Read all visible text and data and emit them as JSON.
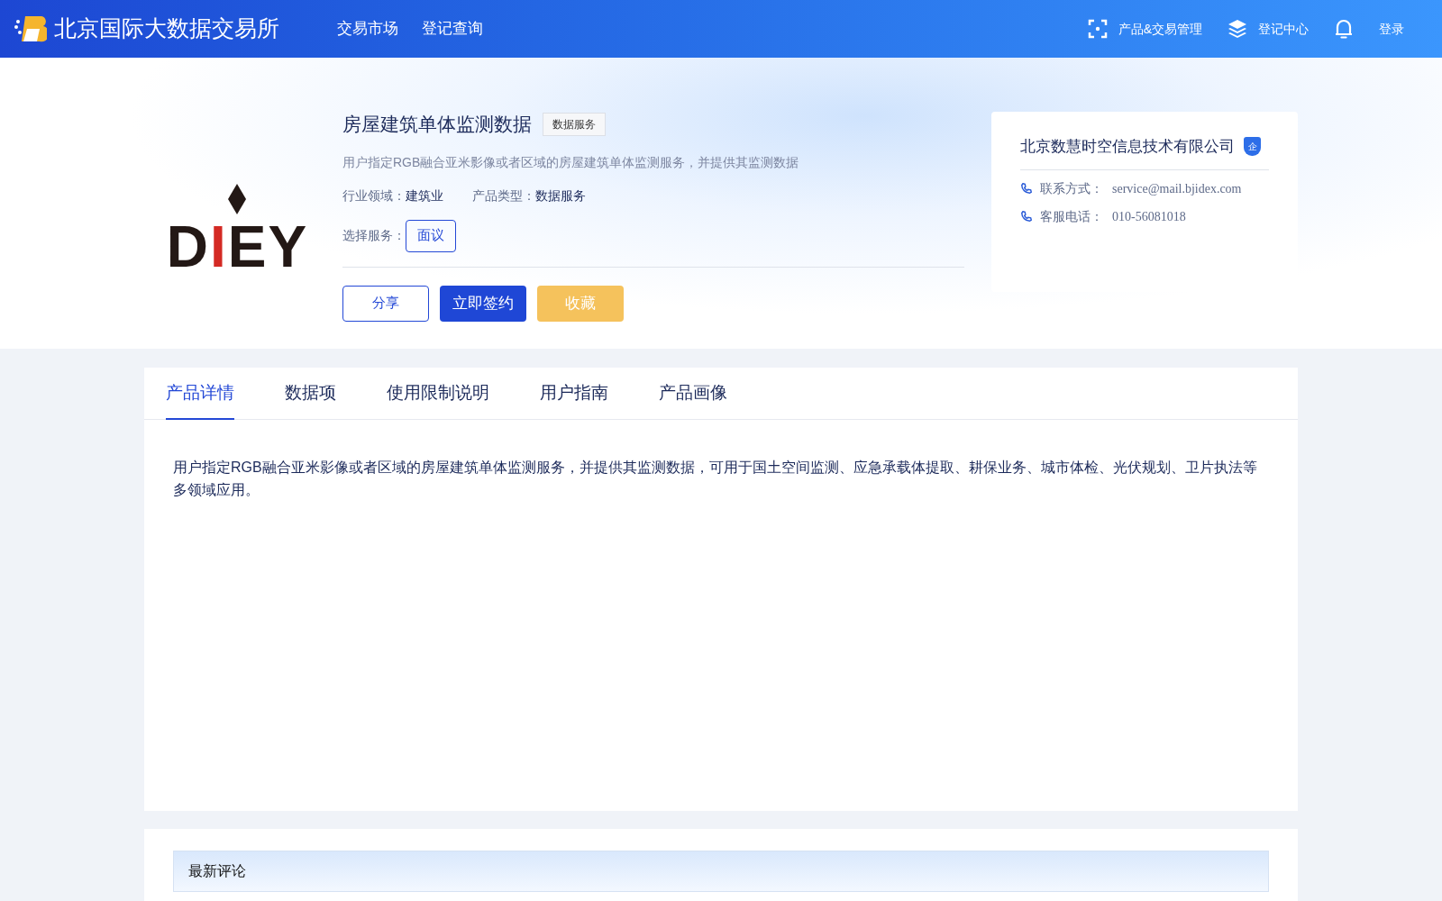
{
  "header": {
    "site_name": "北京国际大数据交易所",
    "nav": [
      {
        "label": "交易市场"
      },
      {
        "label": "登记查询"
      }
    ],
    "actions": [
      {
        "kind": "scan",
        "label": "产品&交易管理"
      },
      {
        "kind": "layers",
        "label": "登记中心"
      },
      {
        "kind": "bell"
      },
      {
        "kind": "text",
        "label": "登录"
      }
    ]
  },
  "product": {
    "logo_letters": [
      {
        "char": "D",
        "color": "#231815"
      },
      {
        "char": "I",
        "color": "#d42a24"
      },
      {
        "char": "E",
        "color": "#231815"
      },
      {
        "char": "Y",
        "color": "#231815"
      }
    ],
    "title": "房屋建筑单体监测数据",
    "tag": "数据服务",
    "description": "用户指定RGB融合亚米影像或者区域的房屋建筑单体监测服务，并提供其监测数据",
    "meta": [
      {
        "label": "行业领域：",
        "value": "建筑业"
      },
      {
        "label": "产品类型：",
        "value": "数据服务"
      }
    ],
    "service_label": "选择服务：",
    "services": [
      {
        "label": "面议",
        "selected": true
      }
    ],
    "buttons": [
      {
        "kind": "outline",
        "label": "分享"
      },
      {
        "kind": "primary",
        "label": "立即签约"
      },
      {
        "kind": "favorite",
        "label": "收藏"
      }
    ]
  },
  "provider": {
    "name": "北京数慧时空信息技术有限公司",
    "badge": "企",
    "contacts": [
      {
        "label": "联系方式：",
        "value": "service@mail.bjidex.com"
      },
      {
        "label": "客服电话：",
        "value": "010-56081018"
      }
    ]
  },
  "tabs": [
    {
      "label": "产品详情",
      "selected": true
    },
    {
      "label": "数据项",
      "selected": false
    },
    {
      "label": "使用限制说明",
      "selected": false
    },
    {
      "label": "用户指南",
      "selected": false
    },
    {
      "label": "产品画像",
      "selected": false
    }
  ],
  "detail_text": "用户指定RGB融合亚米影像或者区域的房屋建筑单体监测服务，并提供其监测数据，可用于国土空间监测、应急承载体提取、耕保业务、城市体检、光伏规划、卫片执法等多领域应用。",
  "comments": {
    "title": "最新评论"
  }
}
